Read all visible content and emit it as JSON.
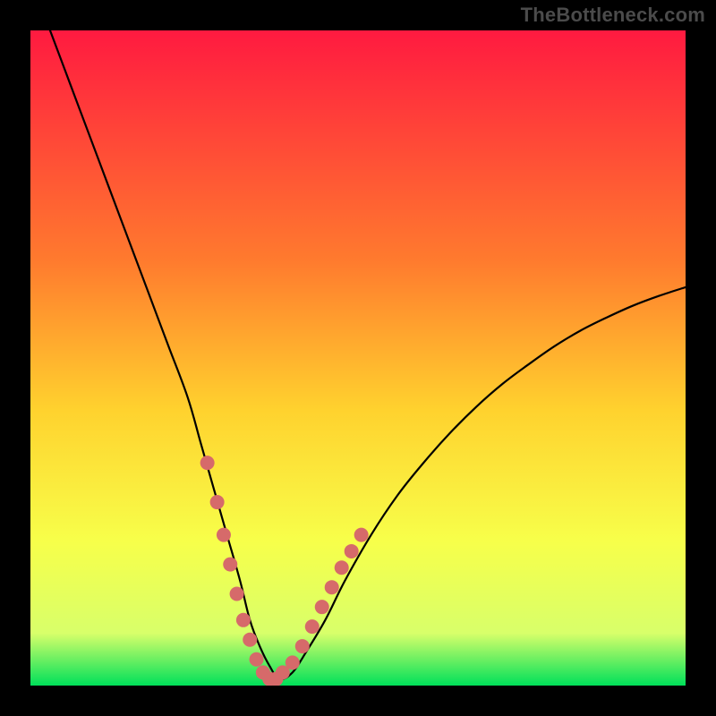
{
  "watermark": "TheBottleneck.com",
  "colors": {
    "frame": "#000000",
    "gradient_top": "#ff1a40",
    "gradient_mid1": "#ff7a2e",
    "gradient_mid2": "#ffd22e",
    "gradient_mid3": "#f7ff4a",
    "gradient_mid4": "#d8ff6a",
    "gradient_bottom": "#00e05a",
    "curve": "#000000",
    "marker_fill": "#d66a6a",
    "marker_stroke": "#c45a5a"
  },
  "chart_data": {
    "type": "line",
    "title": "",
    "xlabel": "",
    "ylabel": "",
    "xlim": [
      0,
      100
    ],
    "ylim": [
      0,
      100
    ],
    "grid": false,
    "legend": false,
    "series": [
      {
        "name": "bottleneck-curve",
        "x": [
          3,
          6,
          9,
          12,
          15,
          18,
          21,
          24,
          26,
          28,
          30,
          32,
          33.5,
          35,
          36.5,
          38,
          40,
          42,
          45,
          48,
          52,
          56,
          60,
          64,
          68,
          72,
          76,
          80,
          84,
          88,
          92,
          96,
          100
        ],
        "y": [
          100,
          92,
          84,
          76,
          68,
          60,
          52,
          44,
          37,
          30,
          23,
          16,
          10,
          6,
          3,
          1,
          2,
          5,
          10,
          16,
          23,
          29,
          34,
          38.5,
          42.5,
          46,
          49,
          51.8,
          54.2,
          56.2,
          58,
          59.5,
          60.8
        ]
      }
    ],
    "markers": {
      "name": "highlighted-points",
      "x": [
        27.0,
        28.5,
        29.5,
        30.5,
        31.5,
        32.5,
        33.5,
        34.5,
        35.5,
        36.5,
        37.5,
        38.5,
        40.0,
        41.5,
        43.0,
        44.5,
        46.0,
        47.5,
        49.0,
        50.5
      ],
      "y": [
        34.0,
        28.0,
        23.0,
        18.5,
        14.0,
        10.0,
        7.0,
        4.0,
        2.0,
        1.0,
        1.0,
        2.0,
        3.5,
        6.0,
        9.0,
        12.0,
        15.0,
        18.0,
        20.5,
        23.0
      ]
    }
  }
}
